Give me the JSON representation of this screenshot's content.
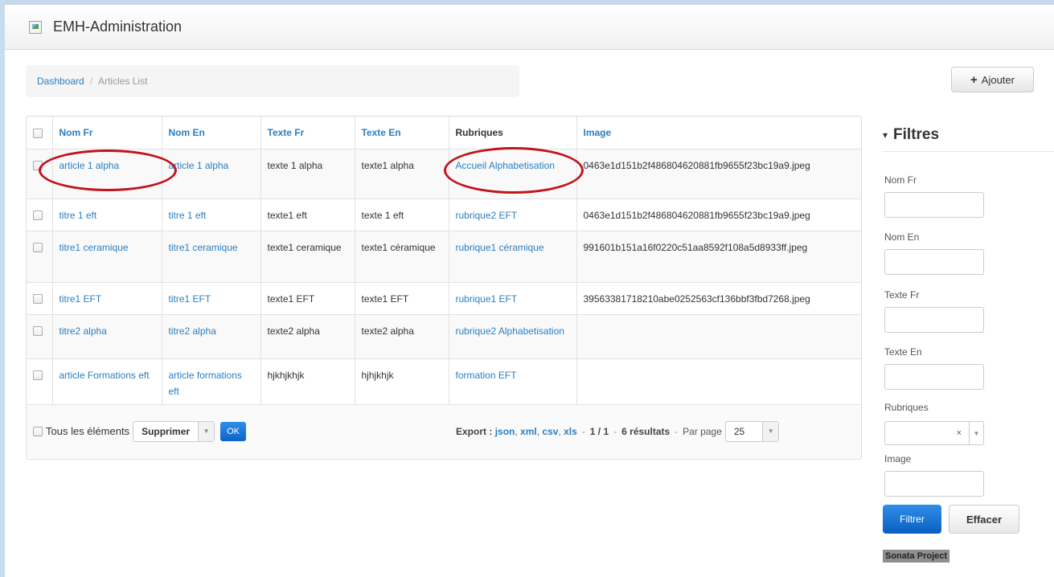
{
  "app": {
    "title": "EMH-Administration"
  },
  "breadcrumb": {
    "home": "Dashboard",
    "separator": "/",
    "current": "Articles List"
  },
  "actions": {
    "add_label": "Ajouter"
  },
  "table": {
    "columns": [
      "Nom Fr",
      "Nom En",
      "Texte Fr",
      "Texte En",
      "Rubriques",
      "Image"
    ],
    "rows": [
      [
        "article 1 alpha",
        "article 1 alpha",
        "texte 1 alpha",
        "texte1 alpha",
        "Accueil Alphabetisation",
        "0463e1d151b2f486804620881fb9655f23bc19a9.jpeg"
      ],
      [
        "titre 1 eft",
        "titre 1 eft",
        "texte1 eft",
        "texte 1 eft",
        "rubrique2 EFT",
        "0463e1d151b2f486804620881fb9655f23bc19a9.jpeg"
      ],
      [
        "titre1 ceramique",
        "titre1 ceramique",
        "texte1 ceramique",
        "texte1 céramique",
        "rubrique1 céramique",
        "991601b151a16f0220c51aa8592f108a5d8933ff.jpeg"
      ],
      [
        "titre1 EFT",
        "titre1 EFT",
        "texte1 EFT",
        "texte1 EFT",
        "rubrique1 EFT",
        "39563381718210abe0252563cf136bbf3fbd7268.jpeg"
      ],
      [
        "titre2 alpha",
        "titre2 alpha",
        "texte2 alpha",
        "texte2 alpha",
        "rubrique2 Alphabetisation",
        ""
      ],
      [
        "article Formations eft",
        "article formations eft",
        "hjkhjkhjk",
        "hjhjkhjk",
        "formation EFT",
        ""
      ]
    ]
  },
  "batch": {
    "all_label": "Tous les éléments",
    "action_value": "Supprimer",
    "ok_label": "OK"
  },
  "export": {
    "label": "Export :",
    "formats": [
      "json",
      "xml",
      "csv",
      "xls"
    ],
    "pages": "1 / 1",
    "results": "6 résultats",
    "per_page_label": "Par page",
    "per_page_value": "25"
  },
  "filters": {
    "title": "Filtres",
    "fields": [
      "Nom Fr",
      "Nom En",
      "Texte Fr",
      "Texte En",
      "Rubriques",
      "Image"
    ],
    "rubriques_clear": "×",
    "submit_label": "Filtrer",
    "reset_label": "Effacer"
  },
  "footer": {
    "badge": "Sonata Project"
  },
  "annotations": {
    "color": "#c0141c"
  }
}
